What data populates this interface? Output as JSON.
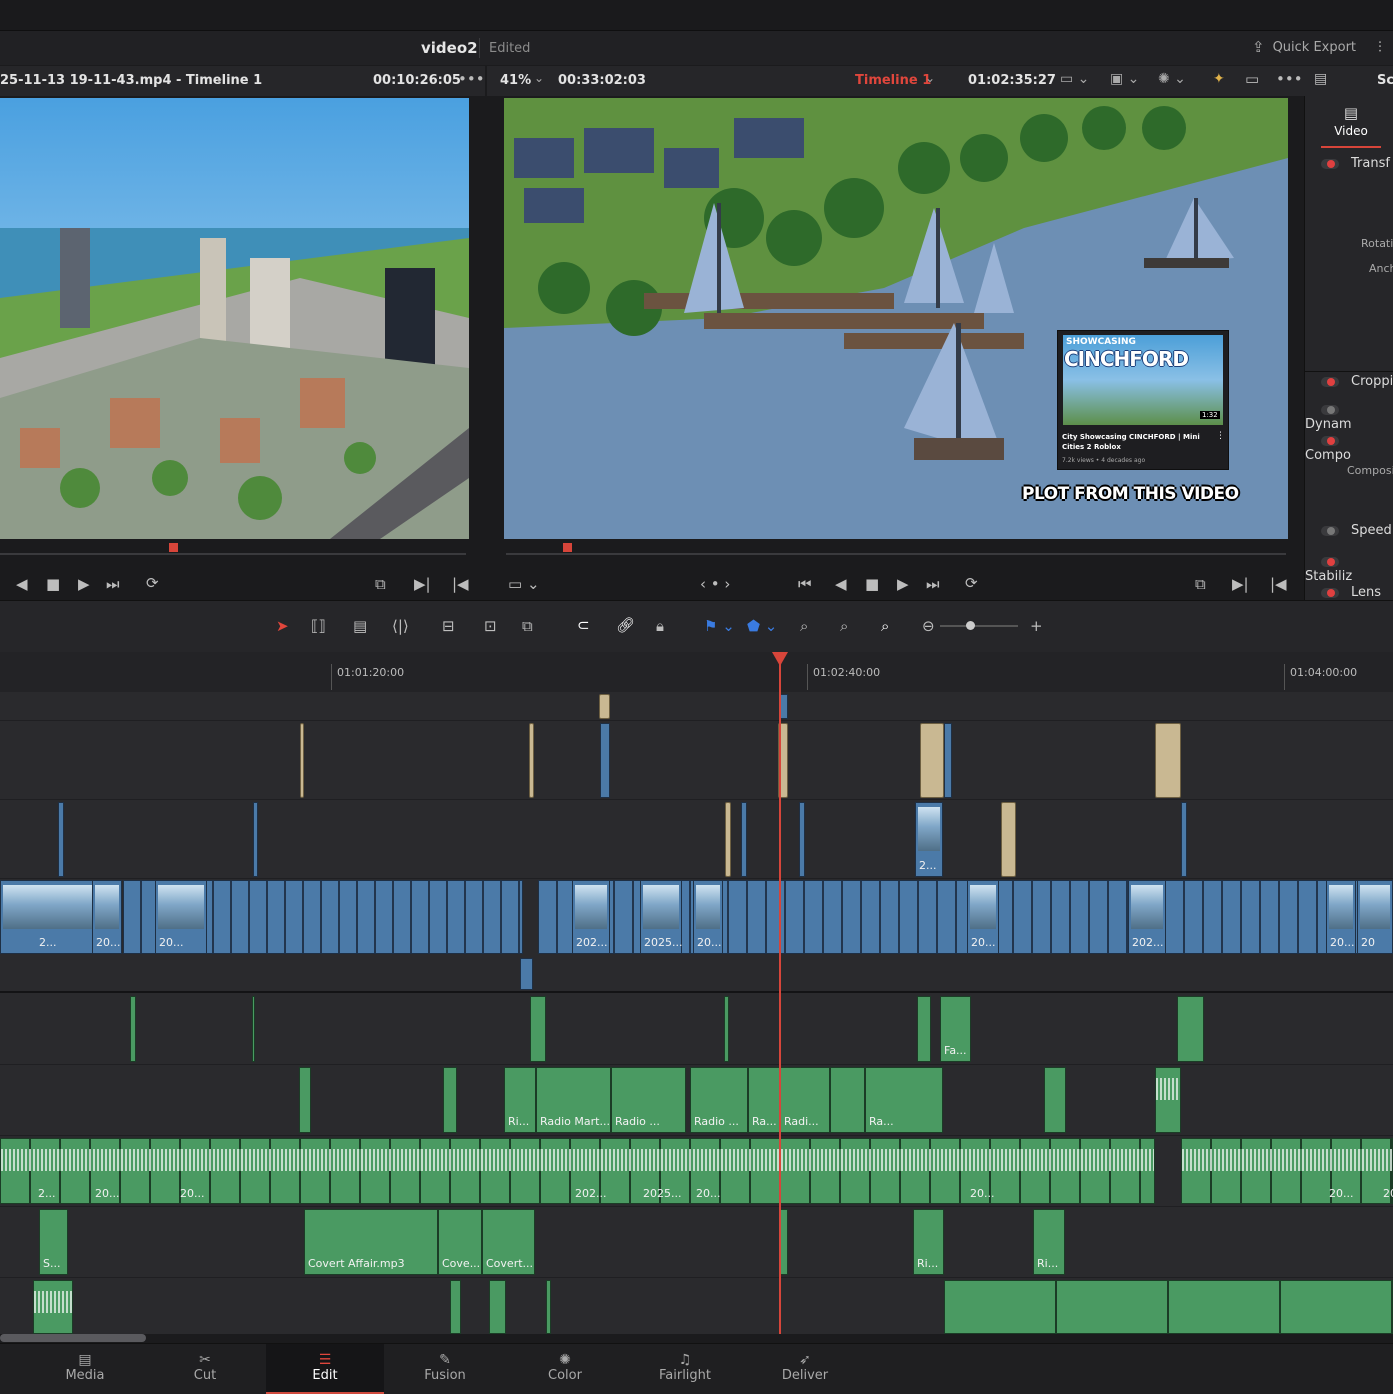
{
  "app": {
    "project_title": "video2",
    "project_status": "Edited",
    "quick_export": "Quick Export"
  },
  "source_viewer": {
    "clip_name": "25-11-13 19-11-43.mp4 - Timeline 1",
    "timecode": "00:10:26:05"
  },
  "timeline_viewer": {
    "zoom": "41%",
    "duration": "00:33:02:03",
    "timeline_name": "Timeline 1",
    "timecode": "01:02:35:27",
    "overlay_title": "PLOT FROM THIS VIDEO",
    "embed_card": {
      "header": "SHOWCASING",
      "big_word": "CINCHFORD",
      "duration": "1:32",
      "video_title": "City Showcasing CINCHFORD | Mini Cities 2 Roblox",
      "meta": "7.2k views • 4 decades ago"
    }
  },
  "inspector": {
    "tab": "Video",
    "sections": [
      "Transf",
      "Croppi",
      "Dynam",
      "Compo",
      "Speed",
      "Stabiliz",
      "Lens C"
    ],
    "sub_labels": [
      "Rotatio",
      "Anch",
      "Composi"
    ],
    "header_cut": "Sc"
  },
  "ruler": {
    "ticks": [
      "01:01:20:00",
      "01:02:40:00",
      "01:04:00:00"
    ]
  },
  "clips": {
    "video_labels": [
      "2...",
      "20...",
      "20...",
      "202...",
      "2025...",
      "20...",
      "20...",
      "202...",
      "20...",
      "20"
    ],
    "overlay_label": "2...",
    "audio_a1": [
      "Fa..."
    ],
    "audio_a2": [
      "Ri...",
      "Radio Mart...",
      "Radio ...",
      "Radio ...",
      "Ra...",
      "Radi...",
      "Ra..."
    ],
    "audio_a3": [
      "2...",
      "20...",
      "20...",
      "202...",
      "2025...",
      "20...",
      "20...",
      "20...",
      "20"
    ],
    "audio_a4": [
      "S...",
      "Covert Affair.mp3",
      "Cove...",
      "Covert...",
      "Ri...",
      "Ri..."
    ]
  },
  "nav": [
    "Media",
    "Cut",
    "Edit",
    "Fusion",
    "Color",
    "Fairlight",
    "Deliver"
  ],
  "colors": {
    "accent": "#d7453a",
    "video_clip": "#4b7aa8",
    "audio_clip": "#4a9a62",
    "title_clip": "#c9b892"
  }
}
